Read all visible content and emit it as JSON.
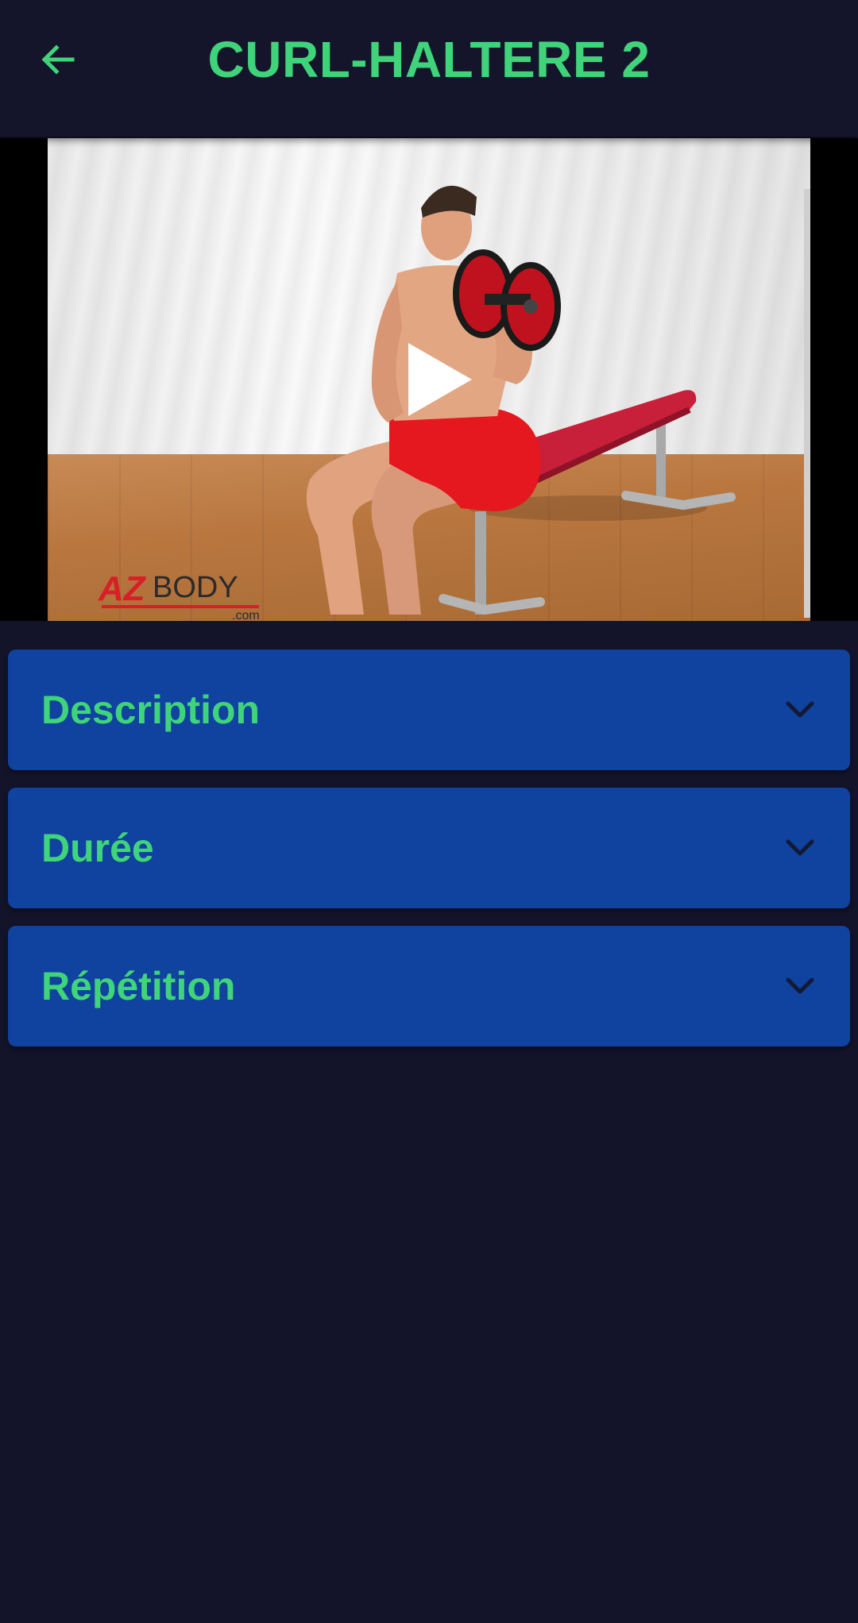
{
  "header": {
    "title": "CURL-HALTERE 2",
    "back_icon": "arrow-left-icon"
  },
  "video": {
    "logo": "AZBODY",
    "logo_suffix": ".com",
    "play_icon": "play-icon"
  },
  "sections": [
    {
      "label": "Description",
      "icon": "chevron-down-icon"
    },
    {
      "label": "Durée",
      "icon": "chevron-down-icon"
    },
    {
      "label": "Répétition",
      "icon": "chevron-down-icon"
    }
  ],
  "colors": {
    "background": "#13142a",
    "accent": "#3fd47a",
    "panel": "#1042a0",
    "chevron": "#121a33"
  }
}
